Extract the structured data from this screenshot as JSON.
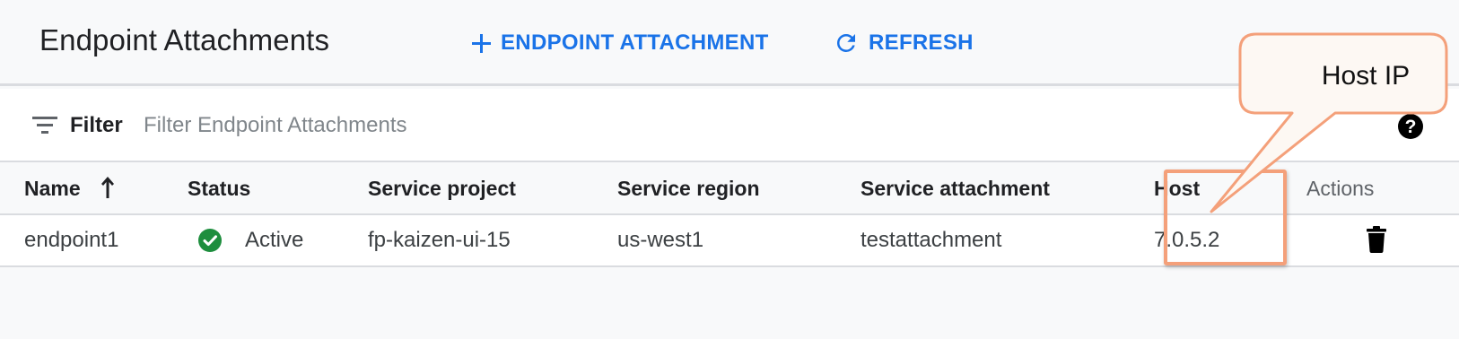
{
  "header": {
    "title": "Endpoint Attachments",
    "add_button": "ENDPOINT ATTACHMENT",
    "refresh_button": "REFRESH"
  },
  "filter": {
    "label": "Filter",
    "placeholder": "Filter Endpoint Attachments"
  },
  "table": {
    "columns": {
      "name": "Name",
      "status": "Status",
      "service_project": "Service project",
      "service_region": "Service region",
      "service_attachment": "Service attachment",
      "host": "Host",
      "actions": "Actions"
    },
    "sort": {
      "column": "name",
      "direction": "ascending"
    },
    "rows": [
      {
        "name": "endpoint1",
        "status": "Active",
        "service_project": "fp-kaizen-ui-15",
        "service_region": "us-west1",
        "service_attachment": "testattachment",
        "host": "7.0.5.2"
      }
    ]
  },
  "annotation": {
    "callout_text": "Host IP"
  },
  "colors": {
    "accent": "#1a73e8",
    "status_active": "#1e8e3e",
    "annotation": "#f4a07a"
  },
  "icons": {
    "add": "plus-icon",
    "refresh": "refresh-icon",
    "filter": "filter-icon",
    "sort": "arrow-up-icon",
    "status": "check-circle-icon",
    "help": "help-icon",
    "delete": "trash-icon"
  }
}
